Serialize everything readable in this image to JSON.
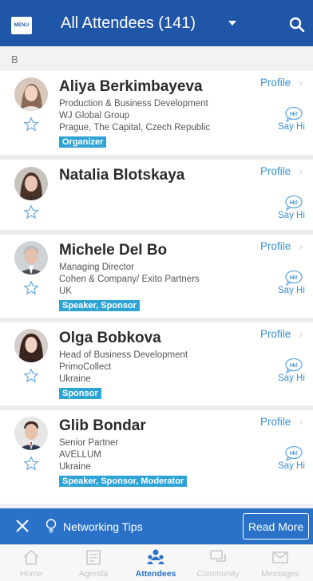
{
  "header": {
    "menu_label": "MENU",
    "title": "All Attendees (141)"
  },
  "section_letter": "B",
  "attendees": [
    {
      "name": "Aliya Berkimbayeva",
      "lines": [
        "Production & Business Development",
        "WJ Global Group",
        "Prague, The Capital, Czech Republic"
      ],
      "tag": "Organizer",
      "profile_label": "Profile",
      "say_hi_label": "Say Hi",
      "say_hi_badge": "Hi!"
    },
    {
      "name": "Natalia Blotskaya",
      "lines": [],
      "tag": "",
      "profile_label": "Profile",
      "say_hi_label": "Say Hi",
      "say_hi_badge": "Hi!"
    },
    {
      "name": "Michele Del Bo",
      "lines": [
        "Managing Director",
        "Cohen & Company/ Exito Partners",
        "UK"
      ],
      "tag": "Speaker, Sponsor",
      "profile_label": "Profile",
      "say_hi_label": "Say Hi",
      "say_hi_badge": "Hi!"
    },
    {
      "name": "Olga Bobkova",
      "lines": [
        "Head of Business Development",
        "PrimoCollect",
        "Ukraine"
      ],
      "tag": "Sponsor",
      "profile_label": "Profile",
      "say_hi_label": "Say Hi",
      "say_hi_badge": "Hi!"
    },
    {
      "name": "Glib Bondar",
      "lines": [
        "Senior Partner",
        "AVELLUM",
        "Ukraine"
      ],
      "tag": "Speaker, Sponsor, Moderator",
      "profile_label": "Profile",
      "say_hi_label": "Say Hi",
      "say_hi_badge": "Hi!"
    }
  ],
  "tips": {
    "label": "Networking Tips",
    "read_more": "Read More"
  },
  "tabs": [
    {
      "label": "Home",
      "icon": "home-icon",
      "active": false
    },
    {
      "label": "Agenda",
      "icon": "agenda-icon",
      "active": false
    },
    {
      "label": "Attendees",
      "icon": "attendees-icon",
      "active": true
    },
    {
      "label": "Community",
      "icon": "community-icon",
      "active": false
    },
    {
      "label": "Messages",
      "icon": "messages-icon",
      "active": false
    }
  ],
  "colors": {
    "header_bg": "#1f56a8",
    "tips_bg": "#2a72c8",
    "tag_bg": "#2ea3d6",
    "link": "#3a8fd0"
  }
}
